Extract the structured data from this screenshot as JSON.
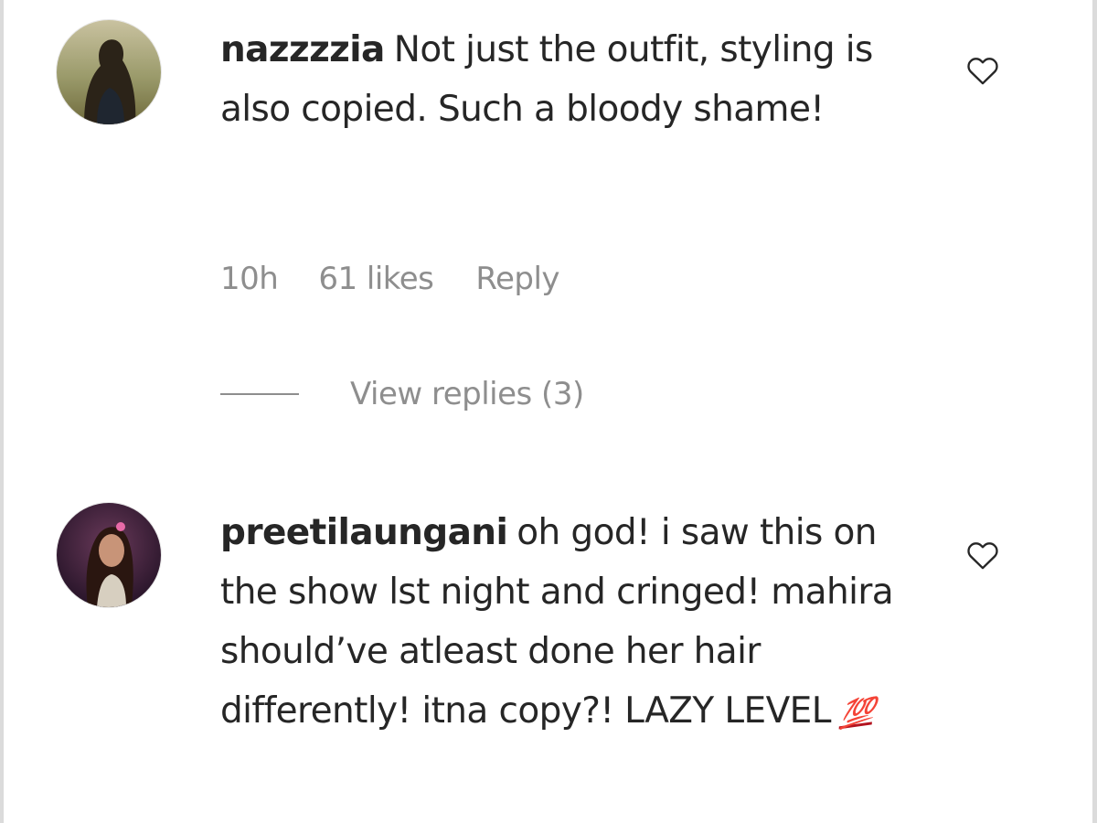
{
  "comments": [
    {
      "username": "nazzzzia",
      "text": "Not just the outfit, styling is also copied. Such a bloody shame!",
      "time": "10h",
      "likes": "61 likes",
      "reply_label": "Reply",
      "view_replies": "View replies (3)"
    },
    {
      "username": "preetilaungani",
      "text": "oh god! i saw this on the show lst night and cringed! mahira should’ve atleast done her hair differently! itna copy?! LAZY LEVEL",
      "emoji": "💯"
    }
  ],
  "icons": {
    "like": "heart-outline-icon",
    "emoji": "hundred-points-emoji"
  },
  "colors": {
    "text": "#262626",
    "secondary": "#8e8e8e",
    "frame": "#dbdbdb"
  }
}
